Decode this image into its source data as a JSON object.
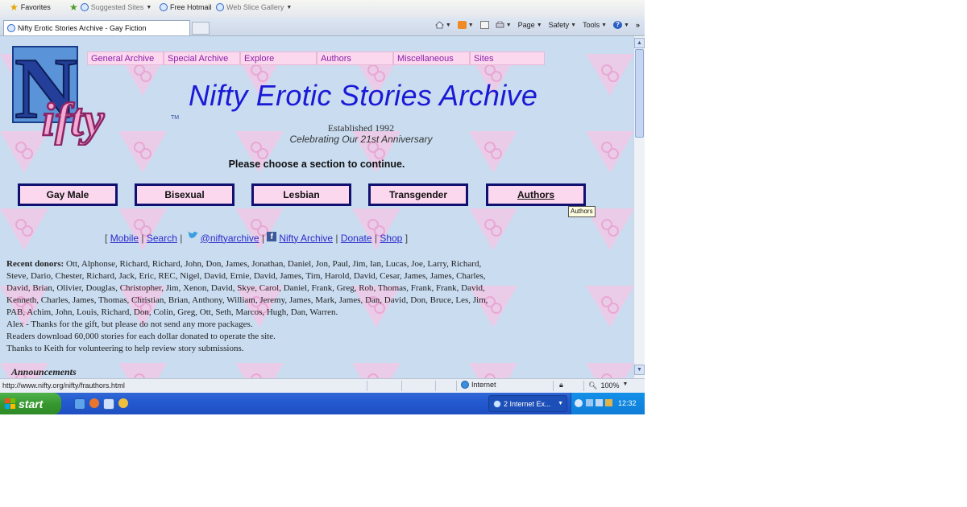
{
  "favorites_bar": {
    "favorites": "Favorites",
    "suggested_sites": "Suggested Sites",
    "free_hotmail": "Free Hotmail",
    "web_slice_gallery": "Web Slice Gallery"
  },
  "tab": {
    "title": "Nifty Erotic Stories Archive - Gay Fiction"
  },
  "command_bar": {
    "page": "Page",
    "safety": "Safety",
    "tools": "Tools",
    "more": "»"
  },
  "page": {
    "nav": [
      "General Archive",
      "Special Archive",
      "Explore",
      "Authors",
      "Miscellaneous",
      "Sites"
    ],
    "title": "Nifty Erotic Stories Archive",
    "tm": "TM",
    "established": "Established 1992",
    "anniversary": "Celebrating Our 21st Anniversary",
    "choose": "Please choose a section to continue.",
    "sections": [
      "Gay Male",
      "Bisexual",
      "Lesbian",
      "Transgender",
      "Authors"
    ],
    "tooltip": "Authors",
    "links": {
      "open": "[",
      "mobile": "Mobile",
      "search": "Search",
      "twitter": "@niftyarchive",
      "facebook": "Nifty Archive",
      "donate": "Donate",
      "shop": "Shop",
      "close": "]"
    },
    "donors_label": "Recent donors:",
    "donors": "Ott, Alphonse, Richard, Richard, John, Don, James, Jonathan, Daniel, Jon, Paul, Jim, Ian, Lucas, Joe, Larry, Richard, Steve, Dario, Chester, Richard, Jack, Eric, REC, Nigel, David, Ernie, David, James, Tim, Harold, David, Cesar, James, James, Charles, David, Brian, Olivier, Douglas, Christopher, Jim, Xenon, David, Skye, Carol, Daniel, Frank, Greg, Rob, Thomas, Frank, Frank, David, Kenneth, Charles, James, Thomas, Christian, Brian, Anthony, William, Jeremy, James, Mark, James, Dan, David, Don, Bruce, Les, Jim, PAB, Achim, John, Louis, Richard, Don, Colin, Greg, Ott, Seth, Marcos, Hugh, Dan, Warren.",
    "alex_note": "Alex - Thanks for the gift, but please do not send any more packages.",
    "readers_note": "Readers download 60,000 stories for each dollar donated to operate the site.",
    "keith_note": "Thanks to Keith for volunteering to help review story submissions.",
    "announcements": "Announcements"
  },
  "status_bar": {
    "url": "http://www.nifty.org/nifty/frauthors.html",
    "zone": "Internet",
    "zoom": "100%"
  },
  "taskbar": {
    "start": "start",
    "task": "2 Internet Ex...",
    "clock": "12:32"
  },
  "colors": {
    "page_bg": "#c9dcf0",
    "nav_bg": "#fbd8ee",
    "title_blue": "#1a1ad6",
    "button_border": "#101070",
    "link_blue": "#2c2cc9"
  }
}
